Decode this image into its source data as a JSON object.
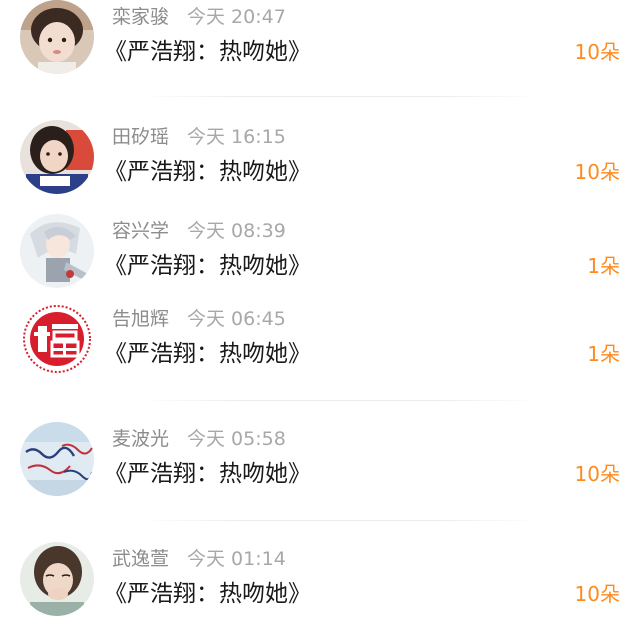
{
  "items": [
    {
      "name": "栾家骏",
      "time": "今天 20:47",
      "gift": "《严浩翔：热吻她》",
      "count": "10朵",
      "avatar_icon": "girl-portrait-avatar"
    },
    {
      "name": "田矽瑶",
      "time": "今天 16:15",
      "gift": "《严浩翔：热吻她》",
      "count": "10朵",
      "avatar_icon": "girl-portrait-avatar"
    },
    {
      "name": "容兴学",
      "time": "今天 08:39",
      "gift": "《严浩翔：热吻她》",
      "count": "1朵",
      "avatar_icon": "anime-character-avatar"
    },
    {
      "name": "告旭辉",
      "time": "今天 06:45",
      "gift": "《严浩翔：热吻她》",
      "count": "1朵",
      "avatar_icon": "fu-seal-avatar"
    },
    {
      "name": "麦波光",
      "time": "今天 05:58",
      "gift": "《严浩翔：热吻她》",
      "count": "10朵",
      "avatar_icon": "handwriting-banner-avatar"
    },
    {
      "name": "武逸萱",
      "time": "今天 01:14",
      "gift": "《严浩翔：热吻她》",
      "count": "10朵",
      "avatar_icon": "girl-selfie-avatar"
    }
  ],
  "colors": {
    "count": "#ff8a1e",
    "name": "#8c8c8c",
    "title": "#1a1a1a",
    "seal_red": "#d81e2c"
  }
}
